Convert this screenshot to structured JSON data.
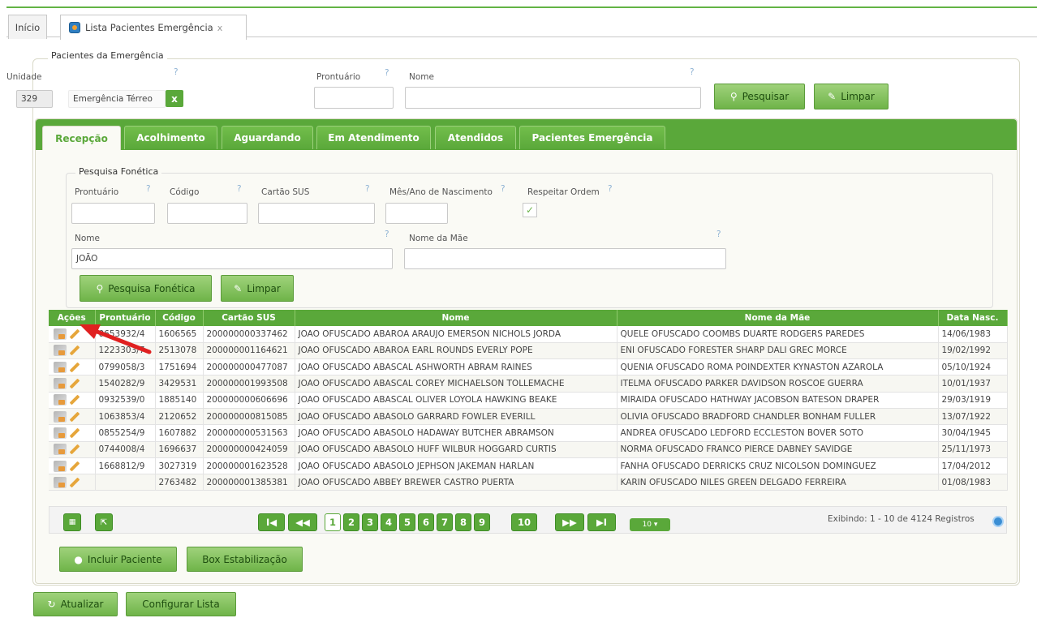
{
  "top_tabs": {
    "home": "Início",
    "active": "Lista Pacientes Emergência",
    "close": "x"
  },
  "panel_title": "Pacientes da Emergência",
  "filters": {
    "unidade_label": "Unidade",
    "unidade_code": "329",
    "unidade_name": "Emergência Térreo",
    "prontuario_label": "Prontuário",
    "nome_label": "Nome",
    "help": "?",
    "clear_x": "x",
    "search_btn": "Pesquisar",
    "clear_btn": "Limpar"
  },
  "inner_tabs": [
    "Recepção",
    "Acolhimento",
    "Aguardando",
    "Em Atendimento",
    "Atendidos",
    "Pacientes Emergência"
  ],
  "fonetica": {
    "title": "Pesquisa Fonética",
    "prontuario_label": "Prontuário",
    "codigo_label": "Código",
    "cartao_label": "Cartão SUS",
    "mesano_label": "Mês/Ano de Nascimento",
    "respeitar_label": "Respeitar Ordem",
    "nome_label": "Nome",
    "nome_value": "JOÃO",
    "mae_label": "Nome da Mãe",
    "search_btn": "Pesquisa Fonética",
    "clear_btn": "Limpar"
  },
  "grid": {
    "headers": [
      "Ações",
      "Prontuário",
      "Código",
      "Cartão SUS",
      "Nome",
      "Nome da Mãe",
      "Data Nasc."
    ],
    "rows": [
      [
        "0653932/4",
        "1606565",
        "200000000337462",
        "JOAO OFUSCADO ABAROA ARAUJO EMERSON NICHOLS JORDA",
        "QUELE OFUSCADO COOMBS DUARTE RODGERS PAREDES",
        "14/06/1983"
      ],
      [
        "1223303/7",
        "2513078",
        "200000001164621",
        "JOAO OFUSCADO ABAROA EARL ROUNDS EVERLY POPE",
        "ENI OFUSCADO FORESTER SHARP DALI GREC MORCE",
        "19/02/1992"
      ],
      [
        "0799058/3",
        "1751694",
        "200000000477087",
        "JOAO OFUSCADO ABASCAL ASHWORTH ABRAM RAINES",
        "QUENIA OFUSCADO ROMA POINDEXTER KYNASTON AZAROLA",
        "05/10/1924"
      ],
      [
        "1540282/9",
        "3429531",
        "200000001993508",
        "JOAO OFUSCADO ABASCAL COREY MICHAELSON TOLLEMACHE",
        "ITELMA OFUSCADO PARKER DAVIDSON ROSCOE GUERRA",
        "10/01/1937"
      ],
      [
        "0932539/0",
        "1885140",
        "200000000606696",
        "JOAO OFUSCADO ABASCAL OLIVER LOYOLA HAWKING BEAKE",
        "MIRAIDA OFUSCADO HATHWAY JACOBSON BATESON DRAPER",
        "29/03/1919"
      ],
      [
        "1063853/4",
        "2120652",
        "200000000815085",
        "JOAO OFUSCADO ABASOLO GARRARD FOWLER EVERILL",
        "OLIVIA OFUSCADO BRADFORD CHANDLER BONHAM FULLER",
        "13/07/1922"
      ],
      [
        "0855254/9",
        "1607882",
        "200000000531563",
        "JOAO OFUSCADO ABASOLO HADAWAY BUTCHER ABRAMSON",
        "ANDREA OFUSCADO LEDFORD ECCLESTON BOVER SOTO",
        "30/04/1945"
      ],
      [
        "0744008/4",
        "1696637",
        "200000000424059",
        "JOAO OFUSCADO ABASOLO HUFF WILBUR HOGGARD CURTIS",
        "NORMA OFUSCADO FRANCO PIERCE DABNEY SAVIDGE",
        "25/11/1973"
      ],
      [
        "1668812/9",
        "3027319",
        "200000001623528",
        "JOAO OFUSCADO ABASOLO JEPHSON JAKEMAN HARLAN",
        "FANHA OFUSCADO DERRICKS CRUZ NICOLSON DOMINGUEZ",
        "17/04/2012"
      ],
      [
        "",
        "2763482",
        "200000001385381",
        "JOAO OFUSCADO ABBEY BREWER CASTRO PUERTA",
        "KARIN OFUSCADO NILES GREEN DELGADO FERREIRA",
        "01/08/1983"
      ]
    ]
  },
  "pager": {
    "first": "I◀",
    "prev": "◀◀",
    "pages": [
      "1",
      "2",
      "3",
      "4",
      "5",
      "6",
      "7",
      "8",
      "9",
      "10"
    ],
    "next": "▶▶",
    "last": "▶I",
    "page_size": "10 ▾",
    "info": "Exibindo: 1 - 10 de 4124 Registros"
  },
  "bottom": {
    "incluir": "Incluir Paciente",
    "box": "Box Estabilização",
    "atualizar": "Atualizar",
    "configurar": "Configurar Lista"
  },
  "colors": {
    "accent": "#5aa83a",
    "annotation": "#e02020"
  }
}
